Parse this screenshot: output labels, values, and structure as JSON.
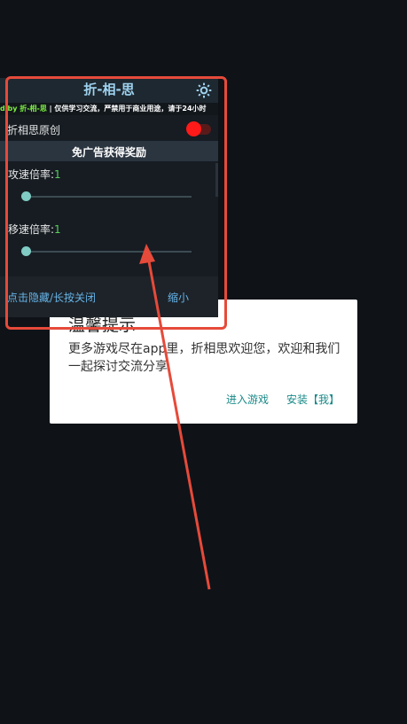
{
  "dialog": {
    "title": "温馨提示",
    "message": "更多游戏尽在app里，折相思欢迎您，欢迎和我们一起探讨交流分享",
    "enter_game_label": "进入游戏",
    "install_label": "安装【我】"
  },
  "menu": {
    "title": "折-相-思",
    "settings_icon": "gear-icon",
    "marquee_by": "d by 折-相-思",
    "marquee_text": " | 仅供学习交流，严禁用于商业用途，请于24小时",
    "toggle_label": "折相思原创",
    "toggle_on": true,
    "section_label": "免广告获得奖励",
    "sliders": [
      {
        "label": "攻速倍率:",
        "value": "1"
      },
      {
        "label": "移速倍率:",
        "value": "1"
      }
    ],
    "footer_left": "点击隐藏/长按关闭",
    "footer_right": "缩小"
  },
  "colors": {
    "background": "#0f1318",
    "accent": "#9ed2ef",
    "toggle": "#ff1a1a",
    "annotation": "#e64a3a",
    "dialog_button": "#1a8a88"
  }
}
